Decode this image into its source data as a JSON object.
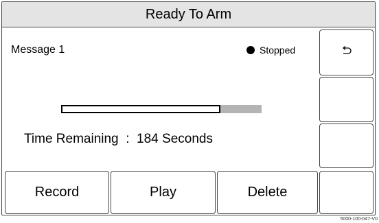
{
  "title": "Ready To Arm",
  "message": {
    "label": "Message 1"
  },
  "status": {
    "label": "Stopped"
  },
  "progress": {
    "fraction": 0.796
  },
  "time": {
    "label": "Time Remaining",
    "separator": ":",
    "value": "184",
    "unit": "Seconds"
  },
  "side_buttons": [
    {
      "icon": "back-arrow-icon",
      "glyph": "↶"
    },
    {
      "label": ""
    },
    {
      "label": ""
    },
    {
      "label": ""
    }
  ],
  "bottom_buttons": {
    "record": "Record",
    "play": "Play",
    "delete": "Delete"
  },
  "footer": {
    "part_number": "5000-100-047-V0"
  }
}
